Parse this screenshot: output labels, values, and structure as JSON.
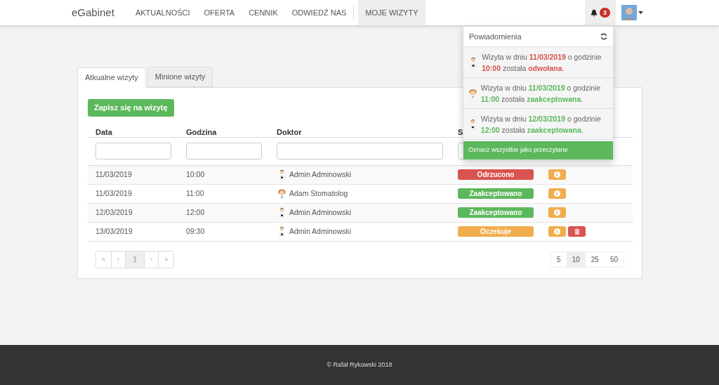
{
  "navbar": {
    "brand": "eGabinet",
    "links": [
      {
        "label": "AKTUALNOŚCI",
        "selected": false
      },
      {
        "label": "OFERTA",
        "selected": false
      },
      {
        "label": "CENNIK",
        "selected": false
      },
      {
        "label": "ODWIEDŹ NAS",
        "selected": false
      },
      {
        "label": "MOJE WIZYTY",
        "selected": true
      }
    ],
    "notification_count": "3"
  },
  "tabs": [
    {
      "label": "Atkualne wizyty",
      "selected": true
    },
    {
      "label": "Minione wizyty",
      "selected": false
    }
  ],
  "signup_button": "Zapisz się na wizytę",
  "table": {
    "columns": [
      "Data",
      "Godzina",
      "Doktor",
      "S"
    ],
    "rows": [
      {
        "date": "11/03/2019",
        "time": "10:00",
        "doctor": "Admin Adminowski",
        "avatar": {
          "kind": "doctor"
        },
        "status": "Odrzucono",
        "kind": "rejected",
        "deletable": false
      },
      {
        "date": "11/03/2019",
        "time": "11:00",
        "doctor": "Adam Stomatolog",
        "avatar": {
          "kind": "cartoon"
        },
        "status": "Zaakceptowano",
        "kind": "accepted",
        "deletable": false
      },
      {
        "date": "12/03/2019",
        "time": "12:00",
        "doctor": "Admin Adminowski",
        "avatar": {
          "kind": "doctor"
        },
        "status": "Zaakceptowano",
        "kind": "accepted",
        "deletable": false
      },
      {
        "date": "13/03/2019",
        "time": "09:30",
        "doctor": "Admin Adminowski",
        "avatar": {
          "kind": "doctor"
        },
        "status": "Oczekuje",
        "kind": "pending",
        "deletable": true
      }
    ]
  },
  "pagination": [
    {
      "label": "«",
      "selected": false
    },
    {
      "label": "‹",
      "selected": false
    },
    {
      "label": "1",
      "selected": true
    },
    {
      "label": "›",
      "selected": false
    },
    {
      "label": "»",
      "selected": false
    }
  ],
  "page_sizes": [
    {
      "label": "5",
      "selected": false
    },
    {
      "label": "10",
      "selected": true
    },
    {
      "label": "25",
      "selected": false
    },
    {
      "label": "50",
      "selected": false
    }
  ],
  "notifications": {
    "title": "Powiadomienia",
    "items": [
      {
        "text": "Wizyta w dniu **11/03/2019** o godzinie **10:00** została **odwołana**.",
        "kind": "rejected",
        "avatar": {
          "kind": "doctor"
        }
      },
      {
        "text": "Wizyta w dniu **11/03/2019** o godzinie **11:00** została **zaakceptowana**.",
        "kind": "accepted",
        "avatar": {
          "kind": "cartoon"
        }
      },
      {
        "text": "Wizyta w dniu **12/03/2019** o godzinie **12:00** została **zaakceptowana**.",
        "kind": "accepted",
        "avatar": {
          "kind": "doctor"
        }
      }
    ],
    "mark_all": "Oznacz wszystkie jako przeczytane"
  },
  "footer": "© Rafał Rykowski 2018"
}
